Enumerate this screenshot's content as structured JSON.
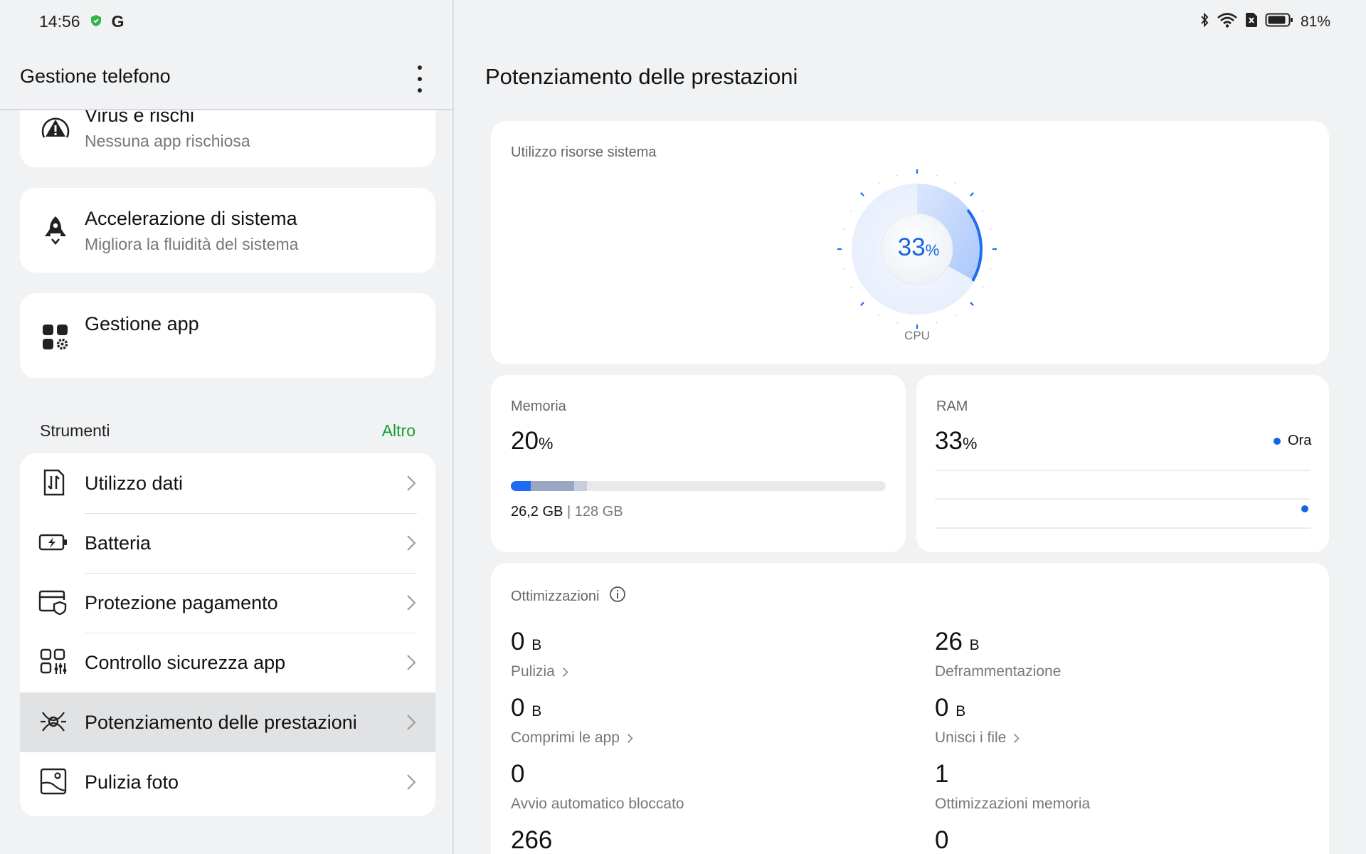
{
  "status_bar": {
    "time": "14:56",
    "google_glyph": "G",
    "battery_percent": "81%",
    "icons": [
      "shield-icon",
      "bluetooth-icon",
      "wifi-icon",
      "sim-off-icon",
      "battery-icon"
    ]
  },
  "left_panel": {
    "header_title": "Gestione telefono",
    "cards": [
      {
        "title": "Virus e rischi",
        "subtitle": "Nessuna app rischiosa",
        "icon": "warning-icon"
      },
      {
        "title": "Accelerazione di sistema",
        "subtitle": "Migliora la fluidità del sistema",
        "icon": "rocket-icon"
      },
      {
        "title": "Gestione app",
        "icon": "apps-gear-icon"
      }
    ],
    "tools_section": {
      "title": "Strumenti",
      "more": "Altro",
      "items": [
        {
          "label": "Utilizzo dati",
          "icon": "data-usage-icon"
        },
        {
          "label": "Batteria",
          "icon": "battery-charge-icon"
        },
        {
          "label": "Protezione pagamento",
          "icon": "payment-shield-icon"
        },
        {
          "label": "Controllo sicurezza app",
          "icon": "app-security-icon"
        },
        {
          "label": "Potenziamento delle prestazioni",
          "icon": "performance-icon",
          "active": true
        },
        {
          "label": "Pulizia foto",
          "icon": "photo-clean-icon"
        }
      ]
    }
  },
  "main": {
    "title": "Potenziamento delle prestazioni",
    "system_resources": {
      "label": "Utilizzo risorse sistema",
      "cpu_value": "33",
      "cpu_unit": "%",
      "cpu_fraction": 0.33,
      "cpu_label": "CPU"
    },
    "memory": {
      "label": "Memoria",
      "value": "20",
      "unit": "%",
      "used": "26,2 GB",
      "separator": "|",
      "total": "128 GB"
    },
    "ram": {
      "label": "RAM",
      "value": "33",
      "unit": "%",
      "legend": "Ora"
    },
    "optimizations": {
      "label": "Ottimizzazioni",
      "items": [
        {
          "value": "0",
          "unit": "B",
          "label": "Pulizia",
          "link": true
        },
        {
          "value": "26",
          "unit": "B",
          "label": "Deframmentazione",
          "link": false
        },
        {
          "value": "0",
          "unit": "B",
          "label": "Comprimi le app",
          "link": true
        },
        {
          "value": "0",
          "unit": "B",
          "label": "Unisci i file",
          "link": true
        },
        {
          "value": "0",
          "unit": "",
          "label": "Avvio automatico bloccato",
          "link": false
        },
        {
          "value": "1",
          "unit": "",
          "label": "Ottimizzazioni memoria",
          "link": false
        },
        {
          "value": "266",
          "unit": "",
          "label": "",
          "link": false
        },
        {
          "value": "0",
          "unit": "",
          "label": "",
          "link": false
        }
      ]
    }
  },
  "colors": {
    "accent_blue": "#1565e0",
    "link_green": "#149c2e",
    "background": "#f1f2f4"
  }
}
